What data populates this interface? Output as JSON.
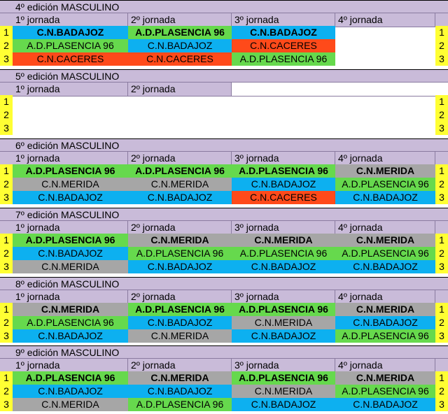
{
  "jornadas": [
    "1º jornada",
    "2º jornada",
    "3º jornada",
    "4º jornada"
  ],
  "positions": [
    "1",
    "2",
    "3"
  ],
  "sections": [
    {
      "title": "4º edición MASCULINO",
      "jornada_count": 4,
      "rows": [
        [
          {
            "t": "C.N.BADAJOZ",
            "c": "blue",
            "b": true
          },
          {
            "t": "A.D.PLASENCIA 96",
            "c": "green",
            "b": true
          },
          {
            "t": "C.N.BADAJOZ",
            "c": "blue",
            "b": true
          },
          {
            "t": "",
            "c": "white",
            "b": false
          }
        ],
        [
          {
            "t": "A.D.PLASENCIA 96",
            "c": "green",
            "b": false
          },
          {
            "t": "C.N.BADAJOZ",
            "c": "blue",
            "b": false
          },
          {
            "t": "C.N.CACERES",
            "c": "red",
            "b": false
          },
          {
            "t": "",
            "c": "white",
            "b": false
          }
        ],
        [
          {
            "t": "C.N.CACERES",
            "c": "red",
            "b": false
          },
          {
            "t": "C.N.CACERES",
            "c": "red",
            "b": false
          },
          {
            "t": "A.D.PLASENCIA 96",
            "c": "green",
            "b": false
          },
          {
            "t": "",
            "c": "white",
            "b": false
          }
        ]
      ]
    },
    {
      "title": "5º edición MASCULINO",
      "jornada_count": 2,
      "rows": [
        [
          {
            "t": "",
            "c": "white",
            "b": false
          },
          {
            "t": "",
            "c": "white",
            "b": false
          },
          {
            "t": "",
            "c": "white",
            "b": false
          },
          {
            "t": "",
            "c": "white",
            "b": false
          }
        ],
        [
          {
            "t": "",
            "c": "white",
            "b": false
          },
          {
            "t": "",
            "c": "white",
            "b": false
          },
          {
            "t": "",
            "c": "white",
            "b": false
          },
          {
            "t": "",
            "c": "white",
            "b": false
          }
        ],
        [
          {
            "t": "",
            "c": "white",
            "b": false
          },
          {
            "t": "",
            "c": "white",
            "b": false
          },
          {
            "t": "",
            "c": "white",
            "b": false
          },
          {
            "t": "",
            "c": "white",
            "b": false
          }
        ]
      ]
    },
    {
      "title": "6º edición MASCULINO",
      "jornada_count": 4,
      "rows": [
        [
          {
            "t": "A.D.PLASENCIA 96",
            "c": "green",
            "b": true
          },
          {
            "t": "A.D.PLASENCIA 96",
            "c": "green",
            "b": true
          },
          {
            "t": "A.D.PLASENCIA 96",
            "c": "green",
            "b": true
          },
          {
            "t": "C.N.MERIDA",
            "c": "gray",
            "b": true
          }
        ],
        [
          {
            "t": "C.N.MERIDA",
            "c": "gray",
            "b": false
          },
          {
            "t": "C.N.MERIDA",
            "c": "gray",
            "b": false
          },
          {
            "t": "C.N.BADAJOZ",
            "c": "blue",
            "b": false
          },
          {
            "t": "A.D.PLASENCIA 96",
            "c": "green",
            "b": false
          }
        ],
        [
          {
            "t": "C.N.BADAJOZ",
            "c": "blue",
            "b": false
          },
          {
            "t": "C.N.BADAJOZ",
            "c": "blue",
            "b": false
          },
          {
            "t": "C.N.CACERES",
            "c": "red",
            "b": false
          },
          {
            "t": "C.N.BADAJOZ",
            "c": "blue",
            "b": false
          }
        ]
      ]
    },
    {
      "title": "7º edición MASCULINO",
      "jornada_count": 4,
      "rows": [
        [
          {
            "t": "A.D.PLASENCIA 96",
            "c": "green",
            "b": true
          },
          {
            "t": "C.N.MERIDA",
            "c": "gray",
            "b": true
          },
          {
            "t": "C.N.MERIDA",
            "c": "gray",
            "b": true
          },
          {
            "t": "C.N.MERIDA",
            "c": "gray",
            "b": true
          }
        ],
        [
          {
            "t": "C.N.BADAJOZ",
            "c": "blue",
            "b": false
          },
          {
            "t": "A.D.PLASENCIA 96",
            "c": "green",
            "b": false
          },
          {
            "t": "A.D.PLASENCIA 96",
            "c": "green",
            "b": false
          },
          {
            "t": "A.D.PLASENCIA 96",
            "c": "green",
            "b": false
          }
        ],
        [
          {
            "t": "C.N.MERIDA",
            "c": "gray",
            "b": false
          },
          {
            "t": "C.N.BADAJOZ",
            "c": "blue",
            "b": false
          },
          {
            "t": "C.N.BADAJOZ",
            "c": "blue",
            "b": false
          },
          {
            "t": "C.N.BADAJOZ",
            "c": "blue",
            "b": false
          }
        ]
      ]
    },
    {
      "title": "8º edición MASCULINO",
      "jornada_count": 4,
      "rows": [
        [
          {
            "t": "C.N.MERIDA",
            "c": "gray",
            "b": true
          },
          {
            "t": "A.D.PLASENCIA 96",
            "c": "green",
            "b": true
          },
          {
            "t": "A.D.PLASENCIA 96",
            "c": "green",
            "b": true
          },
          {
            "t": "C.N.MERIDA",
            "c": "gray",
            "b": true
          }
        ],
        [
          {
            "t": "A.D.PLASENCIA 96",
            "c": "green",
            "b": false
          },
          {
            "t": "C.N.BADAJOZ",
            "c": "blue",
            "b": false
          },
          {
            "t": "C.N.MERIDA",
            "c": "gray",
            "b": false
          },
          {
            "t": "C.N.BADAJOZ",
            "c": "blue",
            "b": false
          }
        ],
        [
          {
            "t": "C.N.BADAJOZ",
            "c": "blue",
            "b": false
          },
          {
            "t": "C.N.MERIDA",
            "c": "gray",
            "b": false
          },
          {
            "t": "C.N.BADAJOZ",
            "c": "blue",
            "b": false
          },
          {
            "t": "A.D.PLASENCIA 96",
            "c": "green",
            "b": false
          }
        ]
      ]
    },
    {
      "title": "9º edición MASCULINO",
      "jornada_count": 4,
      "rows": [
        [
          {
            "t": "A.D.PLASENCIA 96",
            "c": "green",
            "b": true
          },
          {
            "t": "C.N.MERIDA",
            "c": "gray",
            "b": true
          },
          {
            "t": "A.D.PLASENCIA 96",
            "c": "green",
            "b": true
          },
          {
            "t": "C.N.MERIDA",
            "c": "gray",
            "b": true
          }
        ],
        [
          {
            "t": "C.N.BADAJOZ",
            "c": "blue",
            "b": false
          },
          {
            "t": "C.N.BADAJOZ",
            "c": "blue",
            "b": false
          },
          {
            "t": "C.N.MERIDA",
            "c": "gray",
            "b": false
          },
          {
            "t": "A.D.PLASENCIA 96",
            "c": "green",
            "b": false
          }
        ],
        [
          {
            "t": "C.N.MERIDA",
            "c": "gray",
            "b": false
          },
          {
            "t": "A.D.PLASENCIA 96",
            "c": "green",
            "b": false
          },
          {
            "t": "C.N.BADAJOZ",
            "c": "blue",
            "b": false
          },
          {
            "t": "C.N.BADAJOZ",
            "c": "blue",
            "b": false
          }
        ]
      ]
    }
  ],
  "colors": {
    "blue": "#0db0f0",
    "green": "#66d94d",
    "red": "#ff4a1a",
    "gray": "#a6a6a6",
    "white": "#ffffff",
    "header": "#c9bbd9",
    "position": "#ffff33"
  }
}
